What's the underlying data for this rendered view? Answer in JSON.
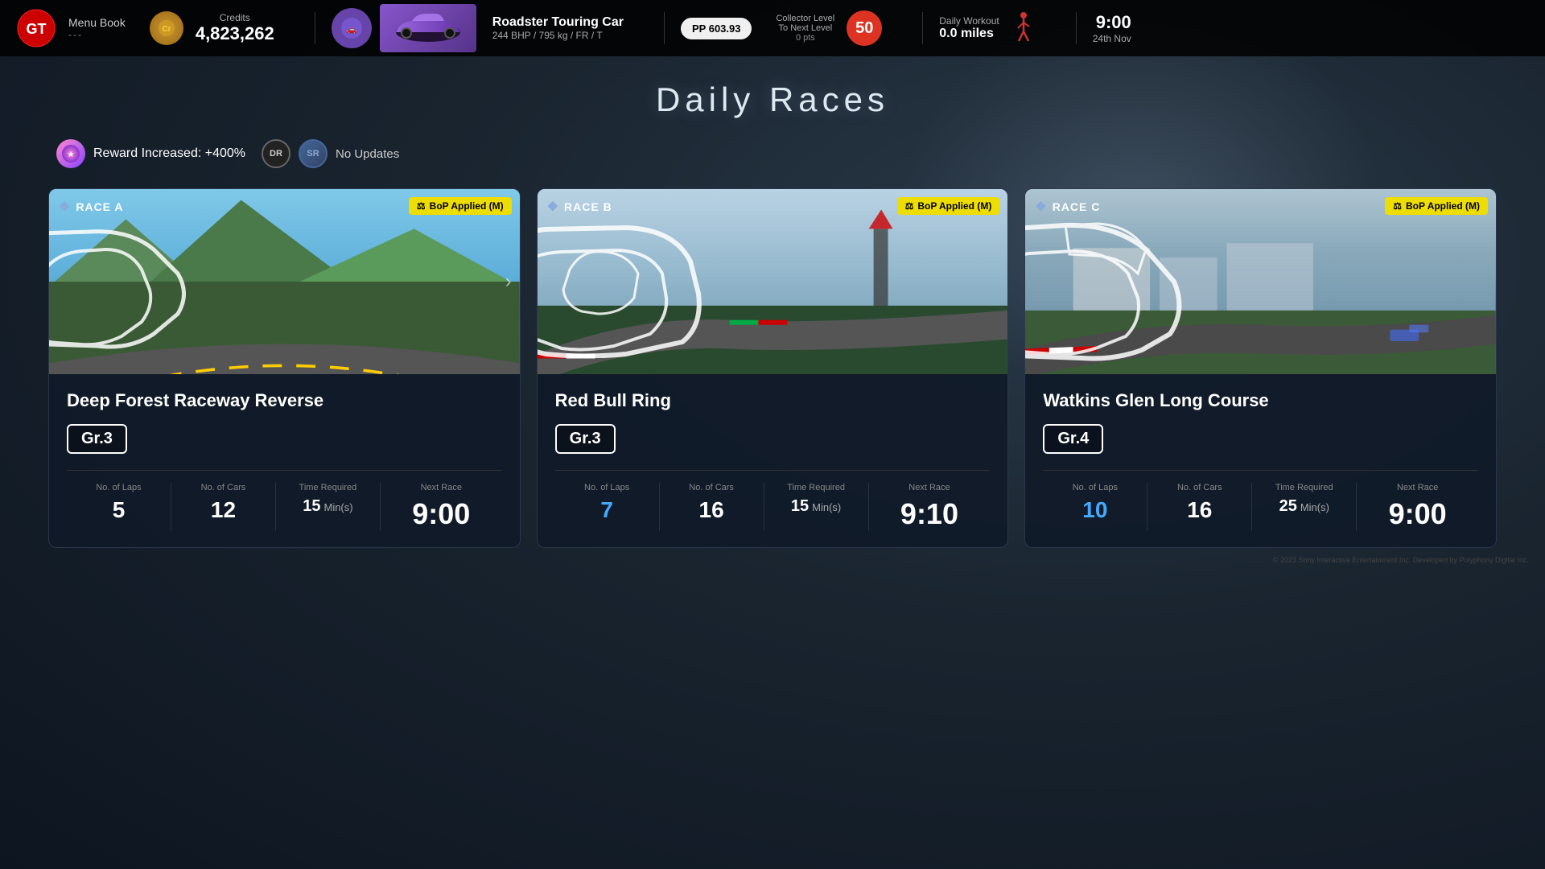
{
  "app": {
    "logo_alt": "GT",
    "menu_book": "Menu Book",
    "menu_book_dots": "---"
  },
  "header": {
    "credits_label": "Credits",
    "credits_value": "4,823,262",
    "car_name": "Roadster Touring Car",
    "car_specs": "244 BHP / 795 kg / FR / T",
    "pp_label": "PP",
    "pp_value": "603.93",
    "collector_label": "Collector Level",
    "collector_sublabel": "To Next Level",
    "collector_pts": "0 pts",
    "collector_level": "50",
    "workout_label": "Daily Workout",
    "workout_value": "0.0 miles",
    "time": "9:00",
    "date": "24th Nov"
  },
  "page": {
    "title": "Daily Races"
  },
  "notifications": {
    "reward_icon": "★",
    "reward_text": "Reward Increased: +400%",
    "dr_label": "DR",
    "sr_label": "SR",
    "no_updates": "No Updates"
  },
  "races": [
    {
      "id": "A",
      "badge_label": "RACE A",
      "bop_label": "BoP Applied (M)",
      "track_name": "Deep Forest Raceway Reverse",
      "gr_class": "Gr.3",
      "laps_label": "No. of Laps",
      "laps_value": "5",
      "cars_label": "No. of Cars",
      "cars_value": "12",
      "time_label": "Time Required",
      "time_value": "15",
      "time_unit": "Min(s)",
      "next_label": "Next Race",
      "next_value": "9:00",
      "laps_color": "white"
    },
    {
      "id": "B",
      "badge_label": "RACE B",
      "bop_label": "BoP Applied (M)",
      "track_name": "Red Bull Ring",
      "gr_class": "Gr.3",
      "laps_label": "No. of Laps",
      "laps_value": "7",
      "cars_label": "No. of Cars",
      "cars_value": "16",
      "time_label": "Time Required",
      "time_value": "15",
      "time_unit": "Min(s)",
      "next_label": "Next Race",
      "next_value": "9:10",
      "laps_color": "blue"
    },
    {
      "id": "C",
      "badge_label": "RACE C",
      "bop_label": "BoP Applied (M)",
      "track_name": "Watkins Glen Long Course",
      "gr_class": "Gr.4",
      "laps_label": "No. of Laps",
      "laps_value": "10",
      "cars_label": "No. of Cars",
      "cars_value": "16",
      "time_label": "Time Required",
      "time_value": "25",
      "time_unit": "Min(s)",
      "next_label": "Next Race",
      "next_value": "9:00",
      "laps_color": "blue"
    }
  ],
  "copyright": "© 2023 Sony Interactive Entertainment Inc. Developed by Polyphony Digital Inc."
}
